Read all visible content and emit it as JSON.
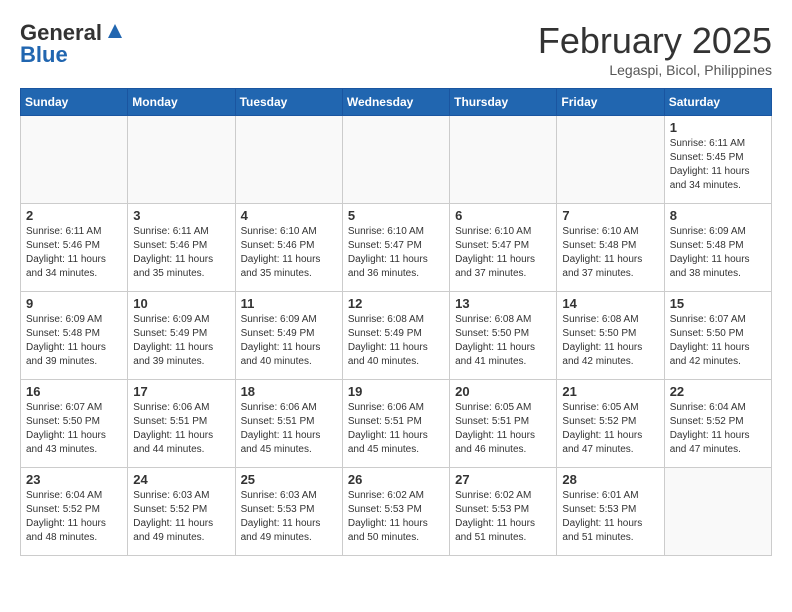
{
  "header": {
    "logo_general": "General",
    "logo_blue": "Blue",
    "month_title": "February 2025",
    "subtitle": "Legaspi, Bicol, Philippines"
  },
  "weekdays": [
    "Sunday",
    "Monday",
    "Tuesday",
    "Wednesday",
    "Thursday",
    "Friday",
    "Saturday"
  ],
  "weeks": [
    [
      {
        "day": "",
        "info": ""
      },
      {
        "day": "",
        "info": ""
      },
      {
        "day": "",
        "info": ""
      },
      {
        "day": "",
        "info": ""
      },
      {
        "day": "",
        "info": ""
      },
      {
        "day": "",
        "info": ""
      },
      {
        "day": "1",
        "info": "Sunrise: 6:11 AM\nSunset: 5:45 PM\nDaylight: 11 hours\nand 34 minutes."
      }
    ],
    [
      {
        "day": "2",
        "info": "Sunrise: 6:11 AM\nSunset: 5:46 PM\nDaylight: 11 hours\nand 34 minutes."
      },
      {
        "day": "3",
        "info": "Sunrise: 6:11 AM\nSunset: 5:46 PM\nDaylight: 11 hours\nand 35 minutes."
      },
      {
        "day": "4",
        "info": "Sunrise: 6:10 AM\nSunset: 5:46 PM\nDaylight: 11 hours\nand 35 minutes."
      },
      {
        "day": "5",
        "info": "Sunrise: 6:10 AM\nSunset: 5:47 PM\nDaylight: 11 hours\nand 36 minutes."
      },
      {
        "day": "6",
        "info": "Sunrise: 6:10 AM\nSunset: 5:47 PM\nDaylight: 11 hours\nand 37 minutes."
      },
      {
        "day": "7",
        "info": "Sunrise: 6:10 AM\nSunset: 5:48 PM\nDaylight: 11 hours\nand 37 minutes."
      },
      {
        "day": "8",
        "info": "Sunrise: 6:09 AM\nSunset: 5:48 PM\nDaylight: 11 hours\nand 38 minutes."
      }
    ],
    [
      {
        "day": "9",
        "info": "Sunrise: 6:09 AM\nSunset: 5:48 PM\nDaylight: 11 hours\nand 39 minutes."
      },
      {
        "day": "10",
        "info": "Sunrise: 6:09 AM\nSunset: 5:49 PM\nDaylight: 11 hours\nand 39 minutes."
      },
      {
        "day": "11",
        "info": "Sunrise: 6:09 AM\nSunset: 5:49 PM\nDaylight: 11 hours\nand 40 minutes."
      },
      {
        "day": "12",
        "info": "Sunrise: 6:08 AM\nSunset: 5:49 PM\nDaylight: 11 hours\nand 40 minutes."
      },
      {
        "day": "13",
        "info": "Sunrise: 6:08 AM\nSunset: 5:50 PM\nDaylight: 11 hours\nand 41 minutes."
      },
      {
        "day": "14",
        "info": "Sunrise: 6:08 AM\nSunset: 5:50 PM\nDaylight: 11 hours\nand 42 minutes."
      },
      {
        "day": "15",
        "info": "Sunrise: 6:07 AM\nSunset: 5:50 PM\nDaylight: 11 hours\nand 42 minutes."
      }
    ],
    [
      {
        "day": "16",
        "info": "Sunrise: 6:07 AM\nSunset: 5:50 PM\nDaylight: 11 hours\nand 43 minutes."
      },
      {
        "day": "17",
        "info": "Sunrise: 6:06 AM\nSunset: 5:51 PM\nDaylight: 11 hours\nand 44 minutes."
      },
      {
        "day": "18",
        "info": "Sunrise: 6:06 AM\nSunset: 5:51 PM\nDaylight: 11 hours\nand 45 minutes."
      },
      {
        "day": "19",
        "info": "Sunrise: 6:06 AM\nSunset: 5:51 PM\nDaylight: 11 hours\nand 45 minutes."
      },
      {
        "day": "20",
        "info": "Sunrise: 6:05 AM\nSunset: 5:51 PM\nDaylight: 11 hours\nand 46 minutes."
      },
      {
        "day": "21",
        "info": "Sunrise: 6:05 AM\nSunset: 5:52 PM\nDaylight: 11 hours\nand 47 minutes."
      },
      {
        "day": "22",
        "info": "Sunrise: 6:04 AM\nSunset: 5:52 PM\nDaylight: 11 hours\nand 47 minutes."
      }
    ],
    [
      {
        "day": "23",
        "info": "Sunrise: 6:04 AM\nSunset: 5:52 PM\nDaylight: 11 hours\nand 48 minutes."
      },
      {
        "day": "24",
        "info": "Sunrise: 6:03 AM\nSunset: 5:52 PM\nDaylight: 11 hours\nand 49 minutes."
      },
      {
        "day": "25",
        "info": "Sunrise: 6:03 AM\nSunset: 5:53 PM\nDaylight: 11 hours\nand 49 minutes."
      },
      {
        "day": "26",
        "info": "Sunrise: 6:02 AM\nSunset: 5:53 PM\nDaylight: 11 hours\nand 50 minutes."
      },
      {
        "day": "27",
        "info": "Sunrise: 6:02 AM\nSunset: 5:53 PM\nDaylight: 11 hours\nand 51 minutes."
      },
      {
        "day": "28",
        "info": "Sunrise: 6:01 AM\nSunset: 5:53 PM\nDaylight: 11 hours\nand 51 minutes."
      },
      {
        "day": "",
        "info": ""
      }
    ]
  ]
}
